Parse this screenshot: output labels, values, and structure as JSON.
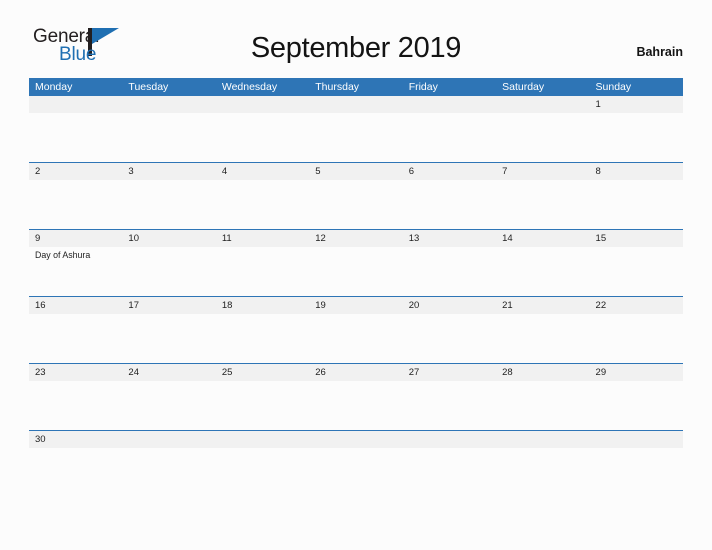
{
  "brand": {
    "name_part1": "General",
    "name_part2": "Blue",
    "flag_icon": "pennant-flag-icon",
    "accent_color": "#1f6fb2"
  },
  "header": {
    "title": "September 2019",
    "region": "Bahrain"
  },
  "theme": {
    "header_bar_color": "#2e75b6",
    "date_band_color": "#f1f1f1",
    "page_background": "#fcfcfc",
    "text_color": "#1f1f1f"
  },
  "calendar": {
    "month": "September",
    "year": "2019",
    "weekday_headers": [
      "Monday",
      "Tuesday",
      "Wednesday",
      "Thursday",
      "Friday",
      "Saturday",
      "Sunday"
    ],
    "weeks": [
      {
        "days": [
          {
            "date": "",
            "events": []
          },
          {
            "date": "",
            "events": []
          },
          {
            "date": "",
            "events": []
          },
          {
            "date": "",
            "events": []
          },
          {
            "date": "",
            "events": []
          },
          {
            "date": "",
            "events": []
          },
          {
            "date": "1",
            "events": []
          }
        ]
      },
      {
        "days": [
          {
            "date": "2",
            "events": []
          },
          {
            "date": "3",
            "events": []
          },
          {
            "date": "4",
            "events": []
          },
          {
            "date": "5",
            "events": []
          },
          {
            "date": "6",
            "events": []
          },
          {
            "date": "7",
            "events": []
          },
          {
            "date": "8",
            "events": []
          }
        ]
      },
      {
        "days": [
          {
            "date": "9",
            "events": [
              "Day of Ashura"
            ]
          },
          {
            "date": "10",
            "events": []
          },
          {
            "date": "11",
            "events": []
          },
          {
            "date": "12",
            "events": []
          },
          {
            "date": "13",
            "events": []
          },
          {
            "date": "14",
            "events": []
          },
          {
            "date": "15",
            "events": []
          }
        ]
      },
      {
        "days": [
          {
            "date": "16",
            "events": []
          },
          {
            "date": "17",
            "events": []
          },
          {
            "date": "18",
            "events": []
          },
          {
            "date": "19",
            "events": []
          },
          {
            "date": "20",
            "events": []
          },
          {
            "date": "21",
            "events": []
          },
          {
            "date": "22",
            "events": []
          }
        ]
      },
      {
        "days": [
          {
            "date": "23",
            "events": []
          },
          {
            "date": "24",
            "events": []
          },
          {
            "date": "25",
            "events": []
          },
          {
            "date": "26",
            "events": []
          },
          {
            "date": "27",
            "events": []
          },
          {
            "date": "28",
            "events": []
          },
          {
            "date": "29",
            "events": []
          }
        ]
      },
      {
        "short": true,
        "days": [
          {
            "date": "30",
            "events": []
          },
          {
            "date": "",
            "events": []
          },
          {
            "date": "",
            "events": []
          },
          {
            "date": "",
            "events": []
          },
          {
            "date": "",
            "events": []
          },
          {
            "date": "",
            "events": []
          },
          {
            "date": "",
            "events": []
          }
        ]
      }
    ]
  }
}
